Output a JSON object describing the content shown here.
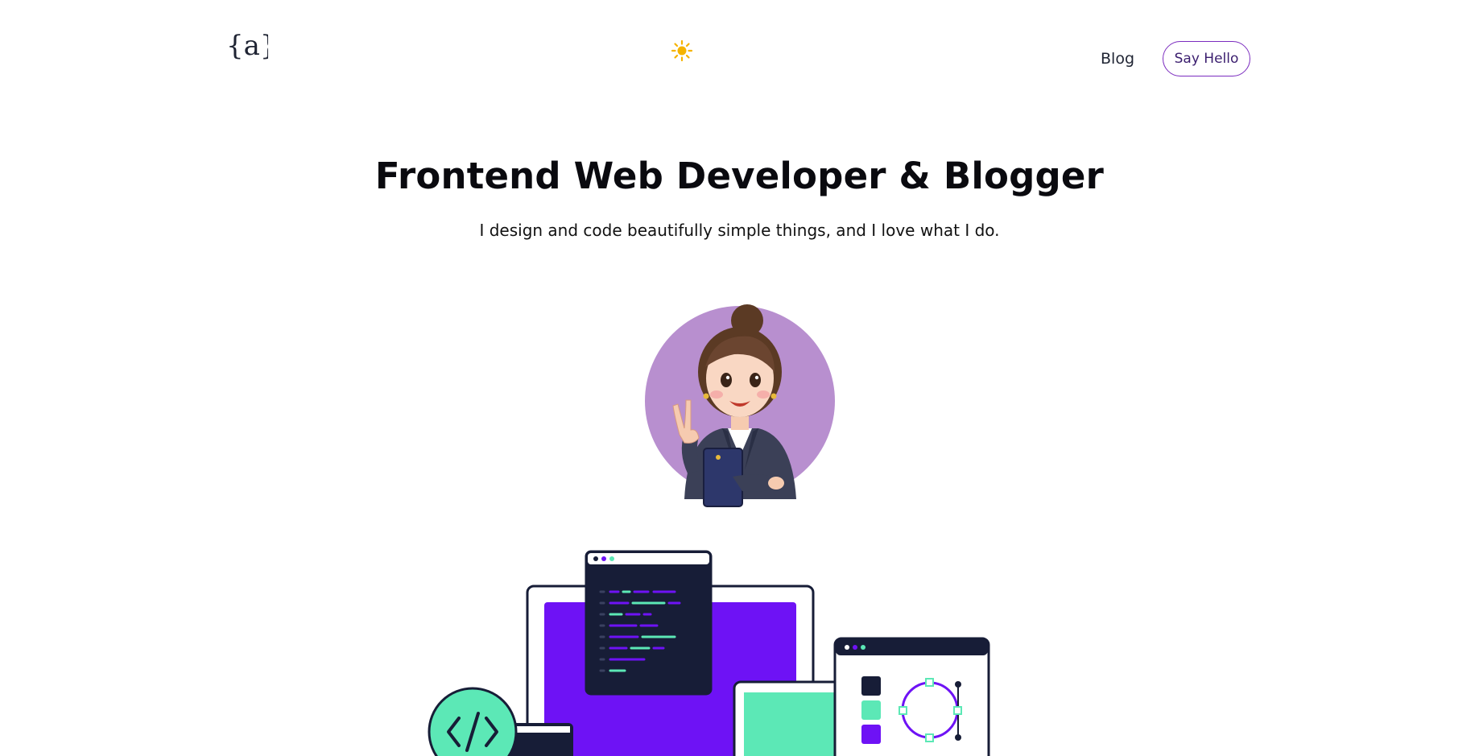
{
  "header": {
    "logo_text": "{a}",
    "theme_icon": "sun-icon",
    "nav": {
      "blog_label": "Blog",
      "cta_label": "Say Hello"
    }
  },
  "hero": {
    "title": "Frontend Web Developer & Blogger",
    "subtitle": "I design and code beautifully simple things, and I love what I do."
  },
  "colors": {
    "accent_purple": "#7b2cbf",
    "illus_purple": "#6e12f5",
    "illus_navy": "#171d37",
    "illus_teal": "#5ce8b6",
    "avatar_circle": "#b88fcf",
    "sun": "#f5b301"
  },
  "icons": [
    "sun-icon",
    "code-icon",
    "avatar-illustration",
    "workspace-illustration"
  ]
}
